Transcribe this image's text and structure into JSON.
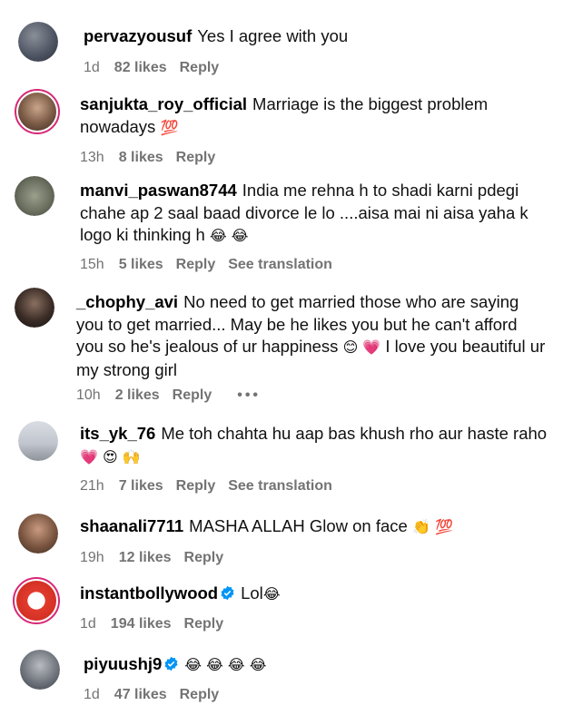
{
  "comments": [
    {
      "username": "pervazyousuf",
      "text": "Yes I agree with you",
      "time": "1d",
      "likes": "82 likes",
      "reply": "Reply"
    },
    {
      "username": "sanjukta_roy_official",
      "text": "Marriage is the biggest problem nowadays",
      "emoji": "💯",
      "time": "13h",
      "likes": "8 likes",
      "reply": "Reply"
    },
    {
      "username": "manvi_paswan8744",
      "text": "India me rehna h to shadi karni pdegi chahe ap 2 saal baad divorce le lo ....aisa mai ni aisa yaha k logo ki thinking h",
      "emoji": "😂 😂",
      "time": "15h",
      "likes": "5 likes",
      "reply": "Reply",
      "translate": "See translation"
    },
    {
      "username": "_chophy_avi",
      "text": "No need to get married those who are saying you to get married... May be he likes you but he can't afford you so he's jealous of ur happiness",
      "emoji": "😊 💗",
      "text2": "I love you beautiful ur my strong girl",
      "time": "10h",
      "likes": "2 likes",
      "reply": "Reply",
      "more": "•••"
    },
    {
      "username": "its_yk_76",
      "text": "Me toh chahta hu aap bas khush rho aur haste raho",
      "emoji": "💗 😍 🙌",
      "time": "21h",
      "likes": "7 likes",
      "reply": "Reply",
      "translate": "See translation"
    },
    {
      "username": "shaanali7711",
      "text": "MASHA ALLAH Glow on face",
      "emoji": "👏 💯",
      "time": "19h",
      "likes": "12 likes",
      "reply": "Reply"
    },
    {
      "username": "instantbollywood",
      "text": "Lol",
      "emoji": "😂",
      "time": "1d",
      "likes": "194 likes",
      "reply": "Reply"
    },
    {
      "username": "piyuushj9",
      "text": "",
      "emoji": "😂 😂 😂 😂",
      "time": "1d",
      "likes": "47 likes",
      "reply": "Reply"
    }
  ],
  "colors": {
    "meta": "#737373",
    "verified": "#0095f6",
    "ring": "#d62976"
  },
  "icons": {
    "verified": "verified-badge-icon",
    "more": "more-options-icon"
  }
}
